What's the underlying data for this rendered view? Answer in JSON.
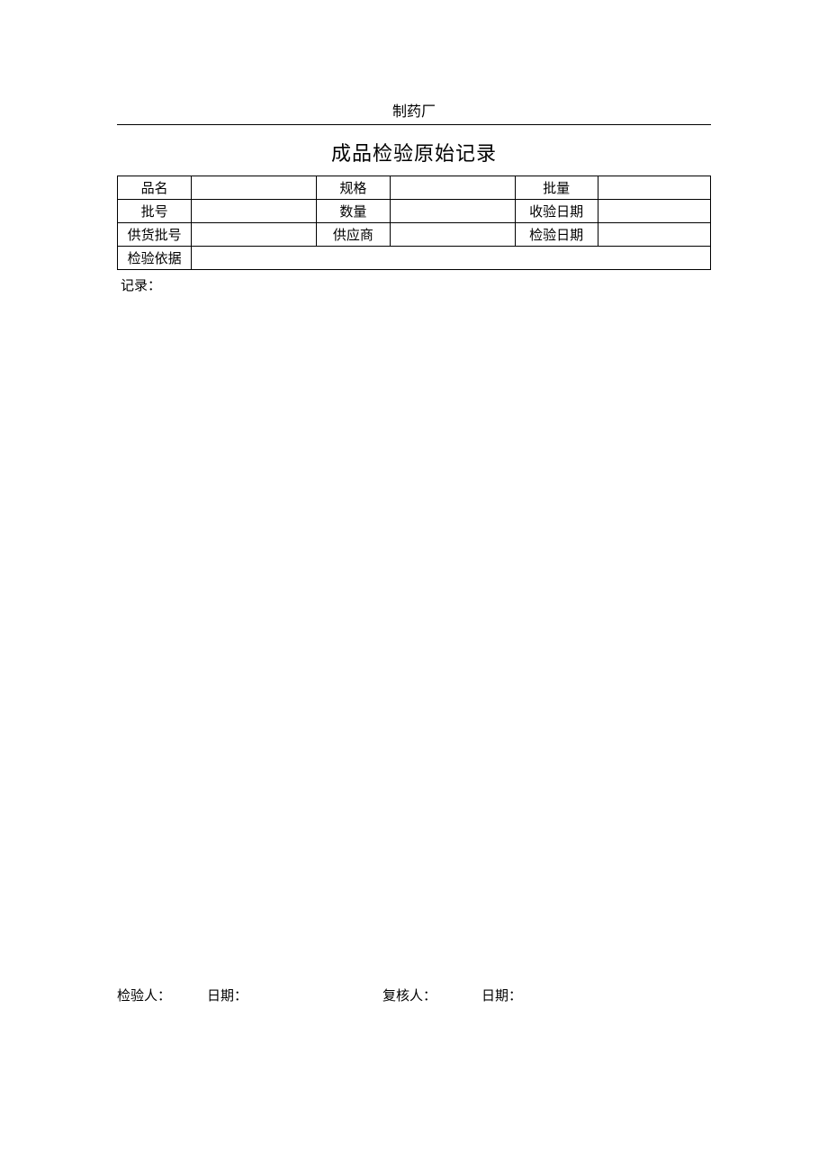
{
  "header": {
    "company": "制药厂",
    "title": "成品检验原始记录"
  },
  "table": {
    "row1": {
      "label1": "品名",
      "val1": "",
      "label2": "规格",
      "val2": "",
      "label3": "批量",
      "val3": ""
    },
    "row2": {
      "label1": "批号",
      "val1": "",
      "label2": "数量",
      "val2": "",
      "label3": "收验日期",
      "val3": ""
    },
    "row3": {
      "label1": "供货批号",
      "val1": "",
      "label2": "供应商",
      "val2": "",
      "label3": "检验日期",
      "val3": ""
    },
    "row4": {
      "label1": "检验依据",
      "val1": ""
    }
  },
  "record_label": "记录：",
  "footer": {
    "inspector_label": "检验人：",
    "date1_label": "日期：",
    "reviewer_label": "复核人：",
    "date2_label": "日期："
  }
}
